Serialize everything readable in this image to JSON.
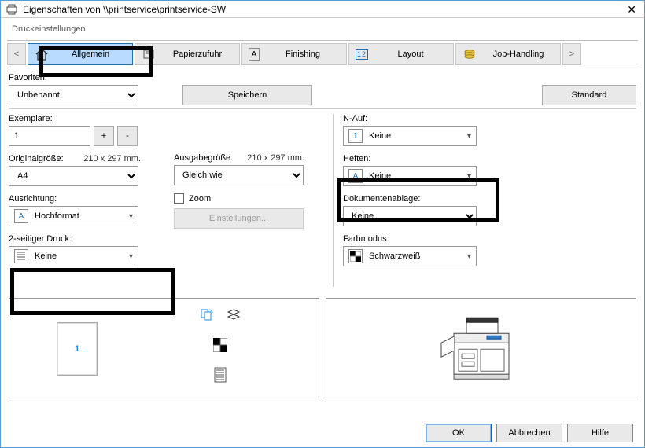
{
  "window": {
    "title": "Eigenschaften von \\\\printservice\\printservice-SW"
  },
  "tab_caption": "Druckeinstellungen",
  "tabs": {
    "prev_glyph": "<",
    "next_glyph": ">",
    "items": [
      {
        "label": "Allgemein"
      },
      {
        "label": "Papierzufuhr"
      },
      {
        "label": "Finishing"
      },
      {
        "label": "Layout"
      },
      {
        "label": "Job-Handling"
      }
    ]
  },
  "favorites": {
    "label": "Favoriten:",
    "value": "Unbenannt",
    "save_label": "Speichern",
    "standard_label": "Standard"
  },
  "left": {
    "copies_label": "Exemplare:",
    "copies_value": "1",
    "plus": "+",
    "minus": "-",
    "original_label": "Originalgröße:",
    "original_size_hint": "210 x 297 mm.",
    "original_value": "A4",
    "orientation_label": "Ausrichtung:",
    "orientation_value": "Hochformat",
    "duplex_label": "2-seitiger Druck:",
    "duplex_value": "Keine"
  },
  "middle": {
    "output_label": "Ausgabegröße:",
    "output_size_hint": "210 x 297 mm.",
    "output_value": "Gleich wie",
    "zoom_label": "Zoom",
    "settings_label": "Einstellungen..."
  },
  "right": {
    "nup_label": "N-Auf:",
    "nup_value": "Keine",
    "staple_label": "Heften:",
    "staple_value": "Keine",
    "tray_label": "Dokumentenablage:",
    "tray_value": "Keine",
    "color_label": "Farbmodus:",
    "color_value": "Schwarzweiß"
  },
  "preview": {
    "page_number": "1"
  },
  "footer": {
    "ok": "OK",
    "cancel": "Abbrechen",
    "help": "Hilfe"
  }
}
